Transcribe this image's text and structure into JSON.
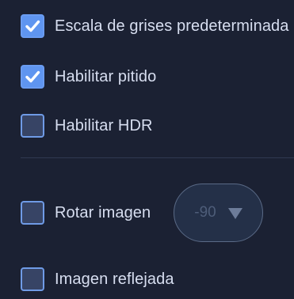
{
  "options": {
    "grayscale_default": {
      "label": "Escala de grises predeterminada",
      "checked": true
    },
    "enable_beep": {
      "label": "Habilitar pitido",
      "checked": true
    },
    "enable_hdr": {
      "label": "Habilitar HDR",
      "checked": false
    },
    "rotate_image": {
      "label": "Rotar imagen",
      "checked": false,
      "rotation_select": {
        "value": "-90"
      }
    },
    "mirror_image": {
      "label": "Imagen reflejada",
      "checked": false
    }
  },
  "icons": {
    "checkmark": "check-icon",
    "dropdown": "chevron-down-icon"
  },
  "colors": {
    "background": "#1b2133",
    "checked_box": "#5f95f0",
    "unchecked_box": "#374465",
    "checkbox_border": "#6f9be6",
    "label_text": "#d7def0",
    "disabled_select_text": "#4e5d79"
  }
}
